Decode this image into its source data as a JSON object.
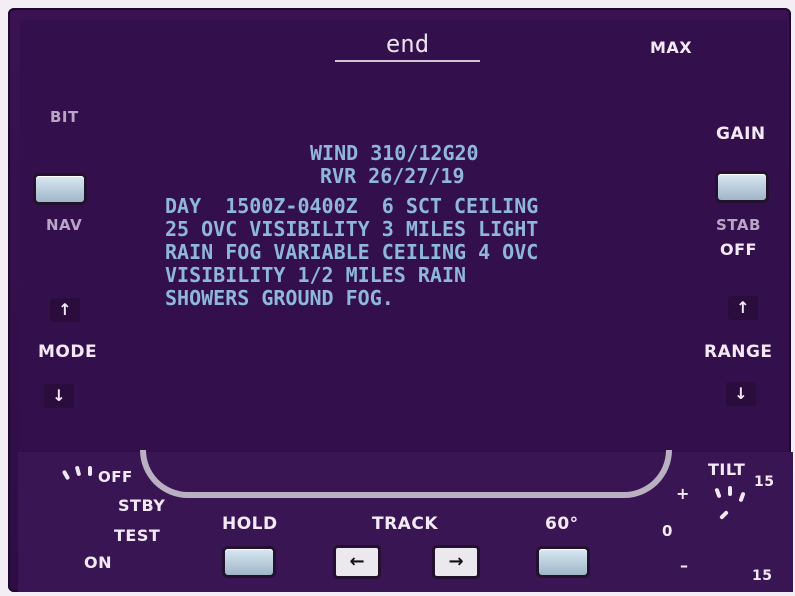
{
  "display": {
    "mode_title": "end",
    "weather_lines": [
      "WIND 310/12G20",
      "RVR 26/27/19",
      "DAY  1500Z-0400Z  6 SCT CEILING",
      "25 OVC VISIBILITY 3 MILES LIGHT",
      "RAIN FOG VARIABLE CEILING 4 OVC",
      "VISIBILITY 1/2 MILES RAIN",
      "SHOWERS GROUND FOG."
    ]
  },
  "left_panel": {
    "bit_label": "BIT",
    "nav_label": "NAV",
    "mode_label": "MODE",
    "up_arrow": "↑",
    "down_arrow": "↓"
  },
  "right_panel": {
    "max_label": "MAX",
    "gain_label": "GAIN",
    "stab_label": "STAB",
    "stab_off_label": "OFF",
    "range_label": "RANGE",
    "up_arrow": "↑",
    "down_arrow": "↓"
  },
  "bottom_panel": {
    "off_label": "OFF",
    "stby_label": "STBY",
    "test_label": "TEST",
    "on_label": "ON",
    "hold_label": "HOLD",
    "track_label": "TRACK",
    "track_left": "←",
    "track_right": "→",
    "sector_label": "60°",
    "tilt_label": "TILT",
    "tilt_top": "15",
    "tilt_bottom": "15",
    "tilt_plus": "+",
    "tilt_zero": "0",
    "tilt_minus": "–"
  }
}
